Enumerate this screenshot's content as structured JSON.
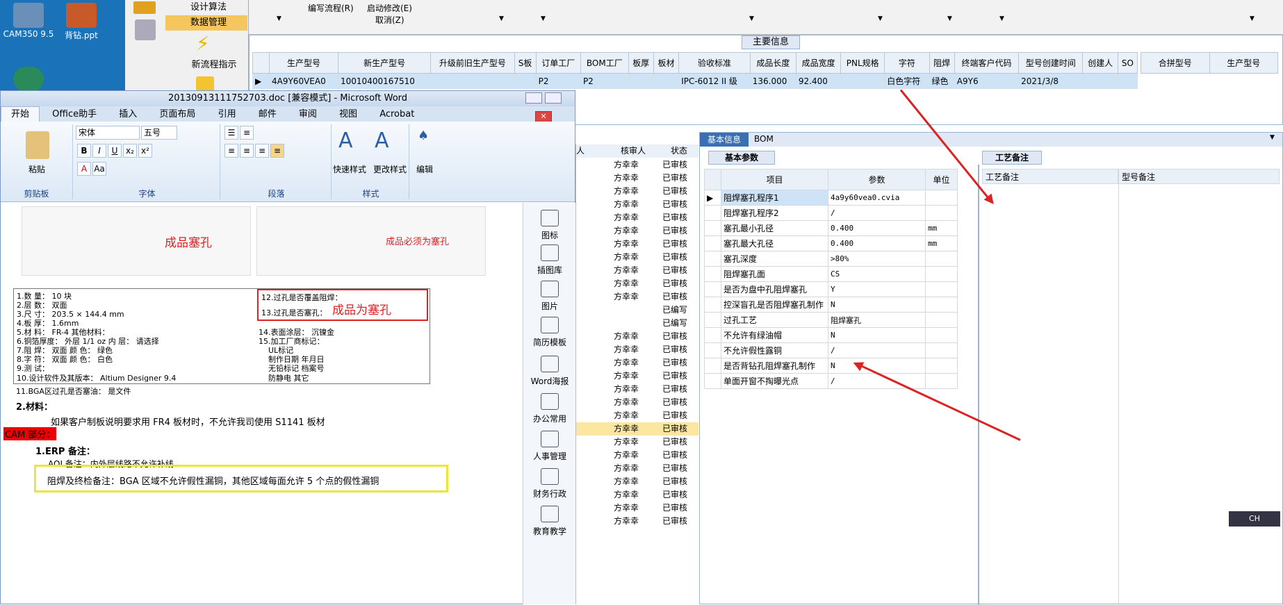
{
  "desktop": {
    "icons": [
      {
        "label": "CAM350 9.5"
      },
      {
        "label": "背钻.ppt"
      }
    ]
  },
  "leftpanel": {
    "items": [
      "设计算法",
      "数据管理",
      "新流程指示"
    ]
  },
  "topbar": {
    "items": [
      "编写流程(R)",
      "启动修改(E)",
      "取消(Z)"
    ]
  },
  "main": {
    "section_title": "主要信息",
    "columns": [
      "生产型号",
      "新生产型号",
      "升级前旧生产型号",
      "S板",
      "订单工厂",
      "BOM工厂",
      "板厚",
      "板材",
      "验收标准",
      "成品长度",
      "成品宽度",
      "PNL规格",
      "字符",
      "阻焊",
      "终端客户代码",
      "型号创建时间",
      "创建人",
      "SO"
    ],
    "right_columns": [
      "合拼型号",
      "生产型号"
    ],
    "row": [
      "4A9Y60VEA0",
      "10010400167510",
      "",
      "",
      "P2",
      "P2",
      "",
      "",
      "IPC-6012 II 级",
      "136.000",
      "92.400",
      "",
      "白色字符",
      "绿色",
      "A9Y6",
      "2021/3/8",
      "",
      ""
    ]
  },
  "word": {
    "title": "20130913111752703.doc [兼容模式] - Microsoft Word",
    "tabs": [
      "开始",
      "Office助手",
      "插入",
      "页面布局",
      "引用",
      "邮件",
      "审阅",
      "视图",
      "Acrobat"
    ],
    "font_name": "宋体",
    "font_size": "五号",
    "groups": [
      "剪贴板",
      "字体",
      "段落",
      "样式",
      "编辑"
    ],
    "paste": "粘贴",
    "quick_style": "快速样式",
    "change_style": "更改样式",
    "edit": "编辑",
    "doc": {
      "heading2": "2.材料：",
      "line1": "如果客户制板说明要求用 FR4 板材时，不允许我司使用 S1141 板材",
      "cam": "CAM 部分：",
      "erp": "1.ERP 备注：",
      "aoi": "AOI 备注：内外层线路不允许补线",
      "highlight": "阻焊及终检备注：BGA 区域不允许假性漏铜，其他区域每面允许 5 个点的假性漏铜",
      "stamp1": "成品塞孔",
      "stamp2": "成品必须为塞孔",
      "stamp3": "成品为塞孔",
      "form": {
        "l1": "1.数  量：",
        "v1": "10",
        "u1": "块",
        "l2": "2.层  数：",
        "v2": "双面",
        "l3": "3.尺  寸：",
        "v3": "203.5",
        "v3b": "144.4",
        "u3": "mm",
        "l4": "4.板  厚：",
        "v4": "1.6mm",
        "l5": "5.材  料：",
        "v5": "FR-4",
        "o5": "其他材料：",
        "l6": "6.铜箔厚度：",
        "v6a": "外层",
        "v6b": "1/1 oz",
        "v6c": "内  层：",
        "v6d": "请选择",
        "l7": "7.阻  焊：",
        "v7": "双面",
        "c7": "颜  色：",
        "d7": "绿色",
        "l8": "8.字  符：",
        "v8": "双面",
        "c8": "颜  色：",
        "d8": "白色",
        "l9": "9.测  试：",
        "l10": "10.设计软件及其版本：",
        "v10": "Altium Designer 9.4",
        "l11": "11.BGA区过孔是否塞油：",
        "r11": "是文件",
        "l12": "12.过孔是否覆盖阻焊：",
        "l13": "13.过孔是否塞孔：",
        "l14": "14.表面涂层：",
        "v14": "沉镍金",
        "l15": "15.加工厂商标记：",
        "ul": "UL标记",
        "date": "制作日期",
        "datev": "年月日",
        "nl": "无铅标记",
        "ant": "防静电",
        "other": "其它",
        "dz": "档案号"
      }
    }
  },
  "vtools": [
    "图标",
    "插图库",
    "图片",
    "简历模板",
    "Word海报",
    "办公常用",
    "人事管理",
    "财务行政",
    "教育教学"
  ],
  "list": {
    "headers": [
      "人",
      "核审人",
      "状态"
    ],
    "reviewer": "方幸幸",
    "status": "已审核",
    "status2": "已编写"
  },
  "basic": {
    "tabs": [
      "基本信息",
      "BOM"
    ],
    "subtab": "基本参数",
    "right_tab": "工艺备注",
    "headers": [
      "项目",
      "参数",
      "单位"
    ],
    "right_headers": [
      "工艺备注",
      "型号备注"
    ],
    "rows": [
      {
        "item": "阻焊塞孔程序1",
        "param": "4a9y60vea0.cvia",
        "unit": ""
      },
      {
        "item": "阻焊塞孔程序2",
        "param": "/",
        "unit": ""
      },
      {
        "item": "塞孔最小孔径",
        "param": "0.400",
        "unit": "mm"
      },
      {
        "item": "塞孔最大孔径",
        "param": "0.400",
        "unit": "mm"
      },
      {
        "item": "塞孔深度",
        "param": ">80%",
        "unit": ""
      },
      {
        "item": "阻焊塞孔面",
        "param": "CS",
        "unit": ""
      },
      {
        "item": "是否为盘中孔阻焊塞孔",
        "param": "Y",
        "unit": ""
      },
      {
        "item": "控深盲孔是否阻焊塞孔制作",
        "param": "N",
        "unit": ""
      },
      {
        "item": "过孔工艺",
        "param": "阻焊塞孔",
        "unit": ""
      },
      {
        "item": "不允许有绿油帽",
        "param": "N",
        "unit": ""
      },
      {
        "item": "不允许假性露铜",
        "param": "/",
        "unit": ""
      },
      {
        "item": "是否背钻孔阻焊塞孔制作",
        "param": "N",
        "unit": ""
      },
      {
        "item": "单面开窗不掏曝光点",
        "param": "/",
        "unit": ""
      }
    ]
  },
  "ime": "CH"
}
